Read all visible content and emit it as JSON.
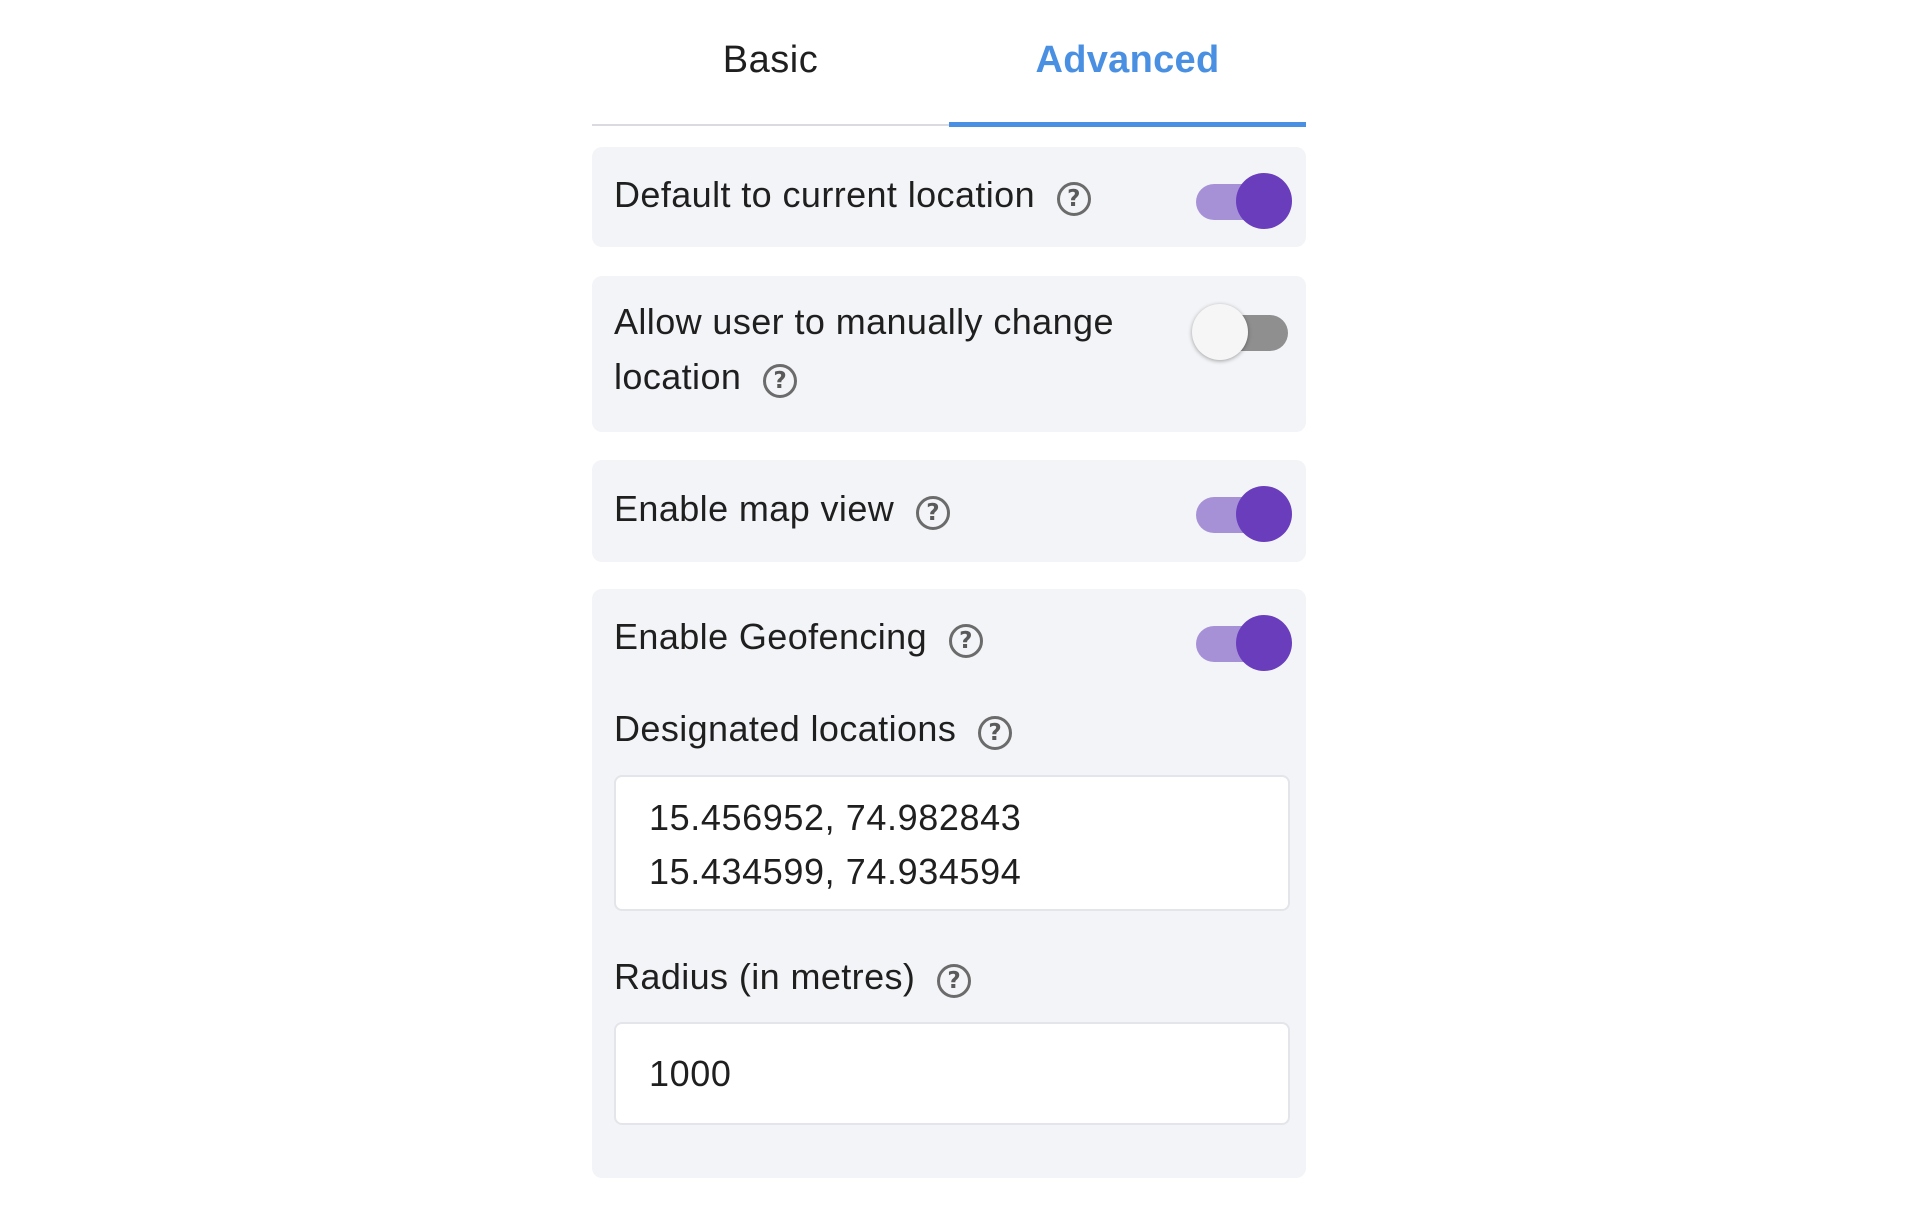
{
  "tabs": {
    "basic_label": "Basic",
    "advanced_label": "Advanced",
    "active": "Advanced"
  },
  "settings": {
    "default_location": {
      "label": "Default to current location",
      "enabled": true
    },
    "manual_change": {
      "label_line1": "Allow user to manually change",
      "label_line2": "location",
      "enabled": false
    },
    "map_view": {
      "label": "Enable map view",
      "enabled": true
    },
    "geofencing": {
      "label": "Enable Geofencing",
      "enabled": true,
      "designated_locations": {
        "label": "Designated locations",
        "values": [
          "15.456952, 74.982843",
          "15.434599, 74.934594"
        ]
      },
      "radius": {
        "label": "Radius (in metres)",
        "value": "1000"
      }
    }
  },
  "help_icon_glyph": "?",
  "colors": {
    "accent_tab": "#4a90e2",
    "toggle_on_knob": "#6a3dbd",
    "toggle_on_track": "#a691d7",
    "toggle_off_track": "#8f8f8f",
    "card_bg": "#f3f4f7"
  }
}
